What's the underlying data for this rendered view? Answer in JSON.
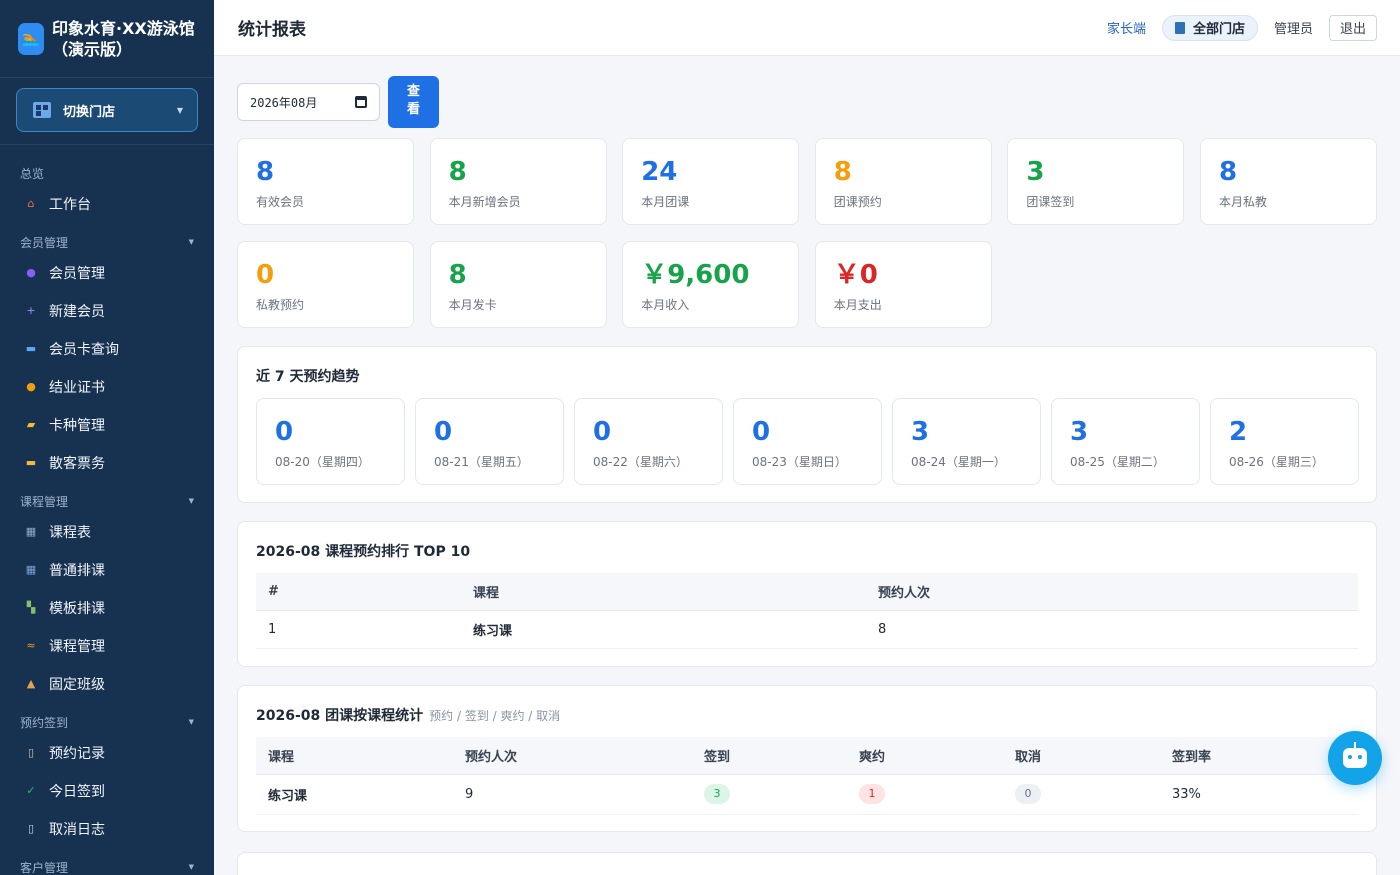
{
  "brand": {
    "logo_icon": "swim-logo-icon",
    "title": "印象水育·XX游泳馆（演示版）"
  },
  "store_switch": {
    "label": "切换门店"
  },
  "sidebar": {
    "groups": [
      {
        "label": "总览",
        "items": [
          {
            "label": "工作台",
            "icon": "home-icon",
            "color": "#e8734a"
          }
        ]
      },
      {
        "label": "会员管理",
        "items": [
          {
            "label": "会员管理",
            "icon": "users-icon",
            "color": "#8b5cf6"
          },
          {
            "label": "新建会员",
            "icon": "plus-icon",
            "color": "#a78bfa"
          },
          {
            "label": "会员卡查询",
            "icon": "card-icon",
            "color": "#60a5fa"
          },
          {
            "label": "结业证书",
            "icon": "medal-icon",
            "color": "#f59e0b"
          },
          {
            "label": "卡种管理",
            "icon": "folder-icon",
            "color": "#fbbf24"
          },
          {
            "label": "散客票务",
            "icon": "ticket-icon",
            "color": "#f5b83b"
          }
        ]
      },
      {
        "label": "课程管理",
        "items": [
          {
            "label": "课程表",
            "icon": "calendar-icon",
            "color": "#93a8c9"
          },
          {
            "label": "普通排课",
            "icon": "schedule-icon",
            "color": "#7aa1d8"
          },
          {
            "label": "模板排课",
            "icon": "template-icon",
            "color": "#86c06c"
          },
          {
            "label": "课程管理",
            "icon": "swim-icon",
            "color": "#f59e0b"
          },
          {
            "label": "固定班级",
            "icon": "school-icon",
            "color": "#e8a04a"
          }
        ]
      },
      {
        "label": "预约签到",
        "items": [
          {
            "label": "预约记录",
            "icon": "clipboard-icon",
            "color": "#d9c39a"
          },
          {
            "label": "今日签到",
            "icon": "checkbox-icon",
            "color": "#22c55e"
          },
          {
            "label": "取消日志",
            "icon": "document-icon",
            "color": "#cbd5e1"
          }
        ]
      },
      {
        "label": "客户管理",
        "items": []
      }
    ]
  },
  "header": {
    "title": "统计报表",
    "parent_link": "家长端",
    "store_pill": "全部门店",
    "user": "管理员",
    "logout": "退出"
  },
  "filter": {
    "month_value": "2026年08月",
    "view_button": "查看"
  },
  "stats": [
    {
      "value": "8",
      "label": "有效会员",
      "color": "#1f6fe5"
    },
    {
      "value": "8",
      "label": "本月新增会员",
      "color": "#16a34a"
    },
    {
      "value": "24",
      "label": "本月团课",
      "color": "#1f6fe5"
    },
    {
      "value": "8",
      "label": "团课预约",
      "color": "#f59e0b"
    },
    {
      "value": "3",
      "label": "团课签到",
      "color": "#16a34a"
    },
    {
      "value": "8",
      "label": "本月私教",
      "color": "#1f6fe5"
    },
    {
      "value": "0",
      "label": "私教预约",
      "color": "#f59e0b"
    },
    {
      "value": "8",
      "label": "本月发卡",
      "color": "#16a34a"
    },
    {
      "value": "￥9,600",
      "label": "本月收入",
      "color": "#16a34a"
    },
    {
      "value": "￥0",
      "label": "本月支出",
      "color": "#dc2626"
    }
  ],
  "trend": {
    "title": "近 7 天预约趋势",
    "days": [
      {
        "value": "0",
        "label": "08-20（星期四）"
      },
      {
        "value": "0",
        "label": "08-21（星期五）"
      },
      {
        "value": "0",
        "label": "08-22（星期六）"
      },
      {
        "value": "0",
        "label": "08-23（星期日）"
      },
      {
        "value": "3",
        "label": "08-24（星期一）"
      },
      {
        "value": "3",
        "label": "08-25（星期二）"
      },
      {
        "value": "2",
        "label": "08-26（星期三）"
      }
    ]
  },
  "ranking": {
    "title": "2026-08 课程预约排行 TOP 10",
    "headers": [
      "#",
      "课程",
      "预约人次"
    ],
    "rows": [
      {
        "rank": "1",
        "course": "练习课",
        "count": "8"
      }
    ]
  },
  "group_stats": {
    "title": "2026-08 团课按课程统计",
    "subtitle": "预约 / 签到 / 爽约 / 取消",
    "headers": [
      "课程",
      "预约人次",
      "签到",
      "爽约",
      "取消",
      "签到率"
    ],
    "rows": [
      {
        "course": "练习课",
        "booked": "9",
        "checked_in": "3",
        "no_show": "1",
        "cancelled": "0",
        "rate": "33%"
      }
    ]
  },
  "assistant": {
    "icon": "robot-icon"
  }
}
